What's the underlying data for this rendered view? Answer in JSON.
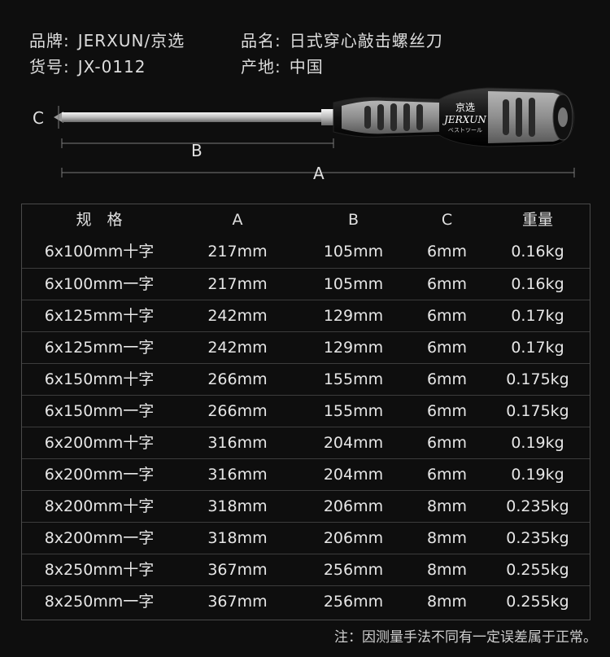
{
  "info": {
    "brand_label": "品牌:",
    "brand_value": "JERXUN/京选",
    "name_label": "品名:",
    "name_value": "日式穿心敲击螺丝刀",
    "model_label": "货号:",
    "model_value": "JX-0112",
    "origin_label": "产地:",
    "origin_value": "中国"
  },
  "product": {
    "logo_cn": "京选",
    "logo_en": "JERXUN",
    "logo_jp": "ベストツール",
    "dim_a": "A",
    "dim_b": "B",
    "dim_c": "C"
  },
  "table": {
    "headers": [
      "规　格",
      "A",
      "B",
      "C",
      "重量"
    ],
    "rows": [
      [
        "6x100mm十字",
        "217mm",
        "105mm",
        "6mm",
        "0.16kg"
      ],
      [
        "6x100mm一字",
        "217mm",
        "105mm",
        "6mm",
        "0.16kg"
      ],
      [
        "6x125mm十字",
        "242mm",
        "129mm",
        "6mm",
        "0.17kg"
      ],
      [
        "6x125mm一字",
        "242mm",
        "129mm",
        "6mm",
        "0.17kg"
      ],
      [
        "6x150mm十字",
        "266mm",
        "155mm",
        "6mm",
        "0.175kg"
      ],
      [
        "6x150mm一字",
        "266mm",
        "155mm",
        "6mm",
        "0.175kg"
      ],
      [
        "6x200mm十字",
        "316mm",
        "204mm",
        "6mm",
        "0.19kg"
      ],
      [
        "6x200mm一字",
        "316mm",
        "204mm",
        "6mm",
        "0.19kg"
      ],
      [
        "8x200mm十字",
        "318mm",
        "206mm",
        "8mm",
        "0.235kg"
      ],
      [
        "8x200mm一字",
        "318mm",
        "206mm",
        "8mm",
        "0.235kg"
      ],
      [
        "8x250mm十字",
        "367mm",
        "256mm",
        "8mm",
        "0.255kg"
      ],
      [
        "8x250mm一字",
        "367mm",
        "256mm",
        "8mm",
        "0.255kg"
      ]
    ]
  },
  "note": "注：因测量手法不同有一定误差属于正常。"
}
